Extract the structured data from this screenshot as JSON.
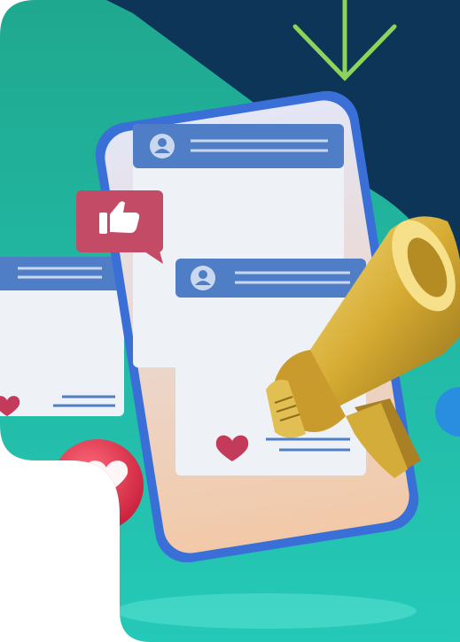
{
  "colors": {
    "navy": "#0d3558",
    "teal": "#1fb3a0",
    "teal_light": "#36d0c0",
    "arrow": "#8cd45a",
    "card": "#eef2f7",
    "card_header": "#4f7ec6",
    "like_badge": "#c44b66",
    "heart": "#c43a5a",
    "phone_frame": "#3a6fd8",
    "megaphone_gold": "#d9b23a",
    "blue_orb": "#2a8ee0"
  },
  "icons": {
    "arrow": "down-arrow-icon",
    "like": "thumbs-up-icon",
    "heart": "heart-icon",
    "avatar": "avatar-icon",
    "megaphone": "megaphone-icon"
  }
}
